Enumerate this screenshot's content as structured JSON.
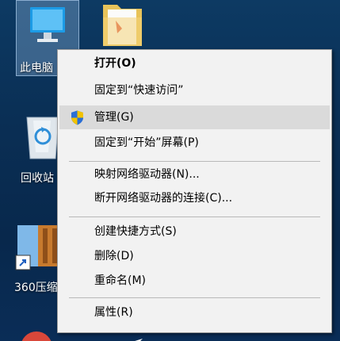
{
  "desktop": {
    "icons": [
      {
        "label": "此电脑"
      },
      {
        "label": ""
      },
      {
        "label": "回收站"
      },
      {
        "label": "360压缩"
      }
    ]
  },
  "context_menu": {
    "items": [
      {
        "label": "打开(O)"
      },
      {
        "label": "固定到“快速访问”"
      },
      {
        "label": "管理(G)"
      },
      {
        "label": "固定到“开始”屏幕(P)"
      },
      {
        "label": "映射网络驱动器(N)..."
      },
      {
        "label": "断开网络驱动器的连接(C)..."
      },
      {
        "label": "创建快捷方式(S)"
      },
      {
        "label": "删除(D)"
      },
      {
        "label": "重命名(M)"
      },
      {
        "label": "属性(R)"
      }
    ]
  },
  "colors": {
    "desktop_bg": "#0b3158",
    "menu_bg": "#f2f2f2",
    "menu_hover": "#dadada",
    "shield_blue": "#2b6fd6",
    "shield_yellow": "#f2c300"
  }
}
